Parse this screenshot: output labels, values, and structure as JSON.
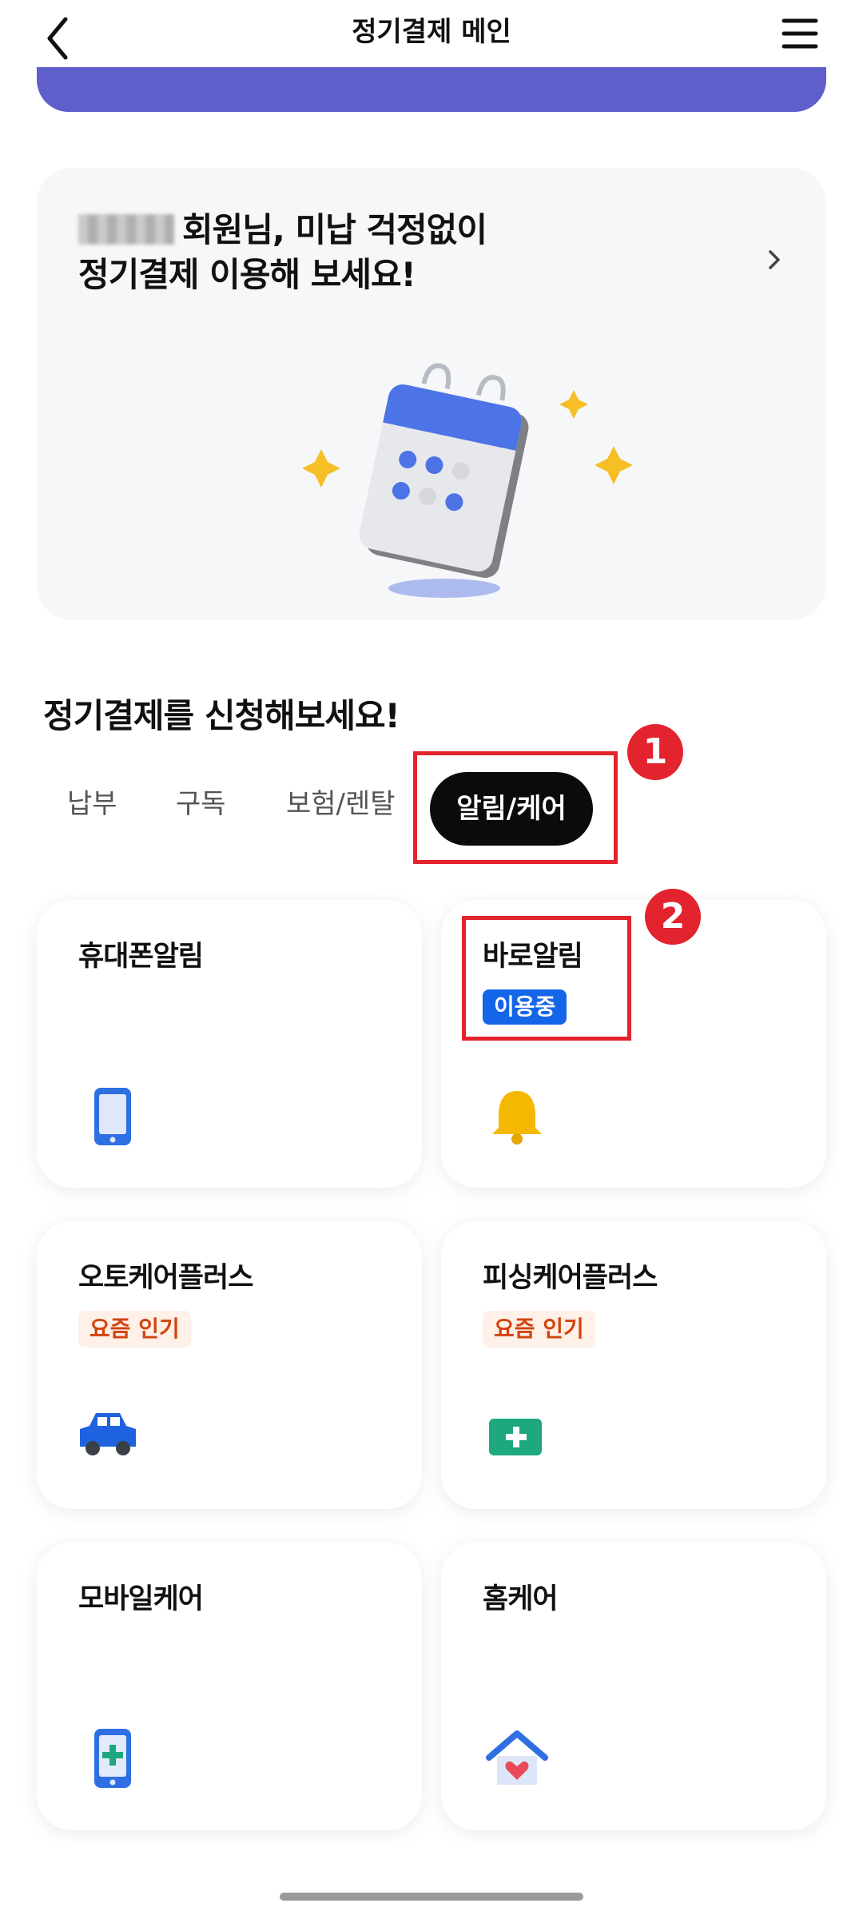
{
  "header": {
    "title": "정기결제 메인",
    "back_icon": "chevron-left-icon",
    "menu_icon": "hamburger-menu-icon"
  },
  "promo": {
    "line1_suffix": "회원님, 미납 걱정없이",
    "line2": "정기결제 이용해 보세요!",
    "chevron_icon": "chevron-right-icon",
    "illustration": "calendar-with-sparkles"
  },
  "section": {
    "title": "정기결제를 신청해보세요!"
  },
  "tabs": [
    {
      "label": "납부"
    },
    {
      "label": "구독"
    },
    {
      "label": "보험/렌탈"
    },
    {
      "label": "알림/케어",
      "active": true
    }
  ],
  "annotations": {
    "first": "1",
    "second": "2",
    "color": "#e3232d"
  },
  "cards": [
    {
      "title": "휴대폰알림",
      "icon": "smartphone-icon"
    },
    {
      "title": "바로알림",
      "badge": "이용중",
      "icon": "bell-icon"
    },
    {
      "title": "오토케어플러스",
      "badge": "요즘 인기",
      "icon": "car-icon"
    },
    {
      "title": "피싱케어플러스",
      "badge": "요즘 인기",
      "icon": "first-aid-kit-icon"
    },
    {
      "title": "모바일케어",
      "icon": "phone-medical-icon"
    },
    {
      "title": "홈케어",
      "icon": "home-heart-icon"
    }
  ],
  "colors": {
    "accent_purple": "#5e5fcb",
    "badge_blue": "#1565e8",
    "badge_orange_text": "#d2440e"
  }
}
